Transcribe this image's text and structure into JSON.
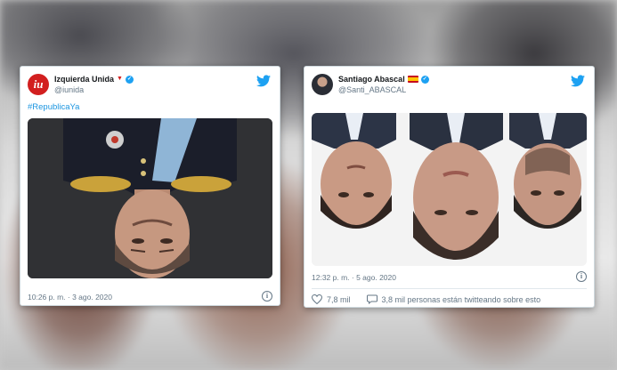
{
  "tweet1": {
    "name": "Izquierda Unida",
    "handle": "@iunida",
    "avatar_text": "iu",
    "hashtag": "#RepublicaYa",
    "timestamp": "10:26 p. m. · 3 ago. 2020"
  },
  "tweet2": {
    "name": "Santiago Abascal",
    "handle": "@Santi_ABASCAL",
    "timestamp": "12:32 p. m. · 5 ago. 2020",
    "likes": "7,8 mil",
    "talking": "3,8 mil personas están twitteando sobre esto"
  },
  "colors": {
    "twitter_blue": "#1da1f2",
    "iu_red": "#d21f1f"
  },
  "icons": [
    "twitter-bird-icon",
    "verified-badge-icon",
    "info-icon",
    "heart-icon",
    "comment-icon",
    "spain-flag-icon",
    "rose-icon"
  ]
}
